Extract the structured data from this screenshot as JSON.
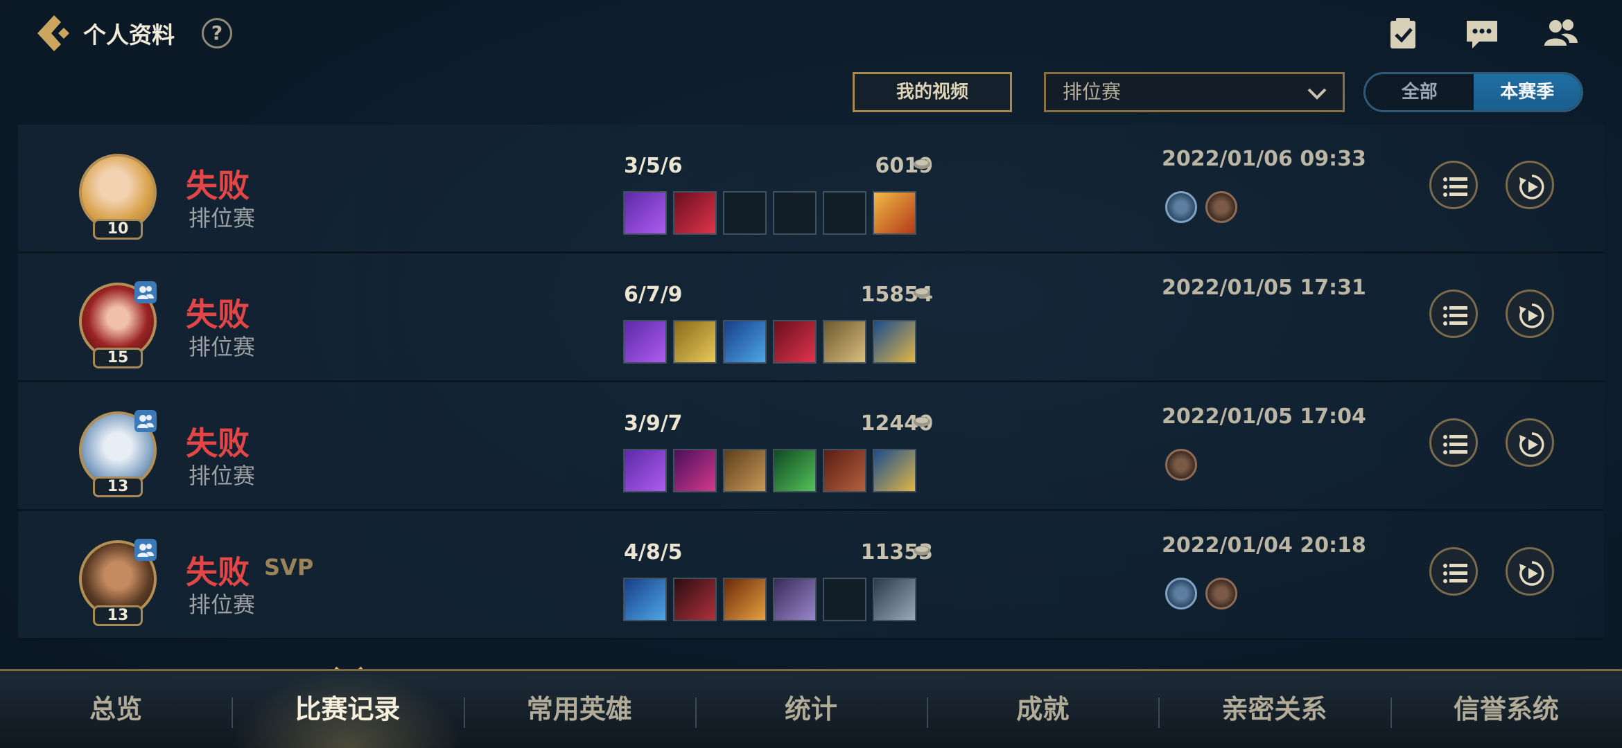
{
  "header": {
    "title": "个人资料",
    "help": "?"
  },
  "filters": {
    "video_label": "我的视频",
    "mode_selected": "排位赛",
    "season_toggle": {
      "all": "全部",
      "season": "本赛季",
      "active": "本赛季"
    }
  },
  "matches": [
    {
      "result": "失败",
      "svp": "",
      "mode": "排位赛",
      "level": "10",
      "kda": "3/5/6",
      "gold": "6019",
      "datetime": "2022/01/06 09:33",
      "party": false,
      "items": [
        "purple",
        "red",
        "empty",
        "empty",
        "empty",
        "sun"
      ],
      "medals": [
        "blue",
        "bronze"
      ]
    },
    {
      "result": "失败",
      "svp": "",
      "mode": "排位赛",
      "level": "15",
      "kda": "6/7/9",
      "gold": "15854",
      "datetime": "2022/01/05 17:31",
      "party": true,
      "items": [
        "purple",
        "gold",
        "blue",
        "red",
        "gold2",
        "ward"
      ],
      "medals": []
    },
    {
      "result": "失败",
      "svp": "",
      "mode": "排位赛",
      "level": "13",
      "kda": "3/9/7",
      "gold": "12440",
      "datetime": "2022/01/05 17:04",
      "party": true,
      "items": [
        "purple",
        "magenta",
        "bronze",
        "green",
        "book",
        "ward"
      ],
      "medals": [
        "bronze"
      ]
    },
    {
      "result": "失败",
      "svp": "SVP",
      "mode": "排位赛",
      "level": "13",
      "kda": "4/8/5",
      "gold": "11353",
      "datetime": "2022/01/04 20:18",
      "party": true,
      "items": [
        "blue",
        "darkred",
        "orange",
        "violet",
        "empty",
        "gray"
      ],
      "medals": [
        "blue",
        "bronze"
      ]
    }
  ],
  "nav": {
    "items": [
      "总览",
      "比赛记录",
      "常用英雄",
      "统计",
      "成就",
      "亲密关系",
      "信誉系统"
    ],
    "active": "比赛记录"
  },
  "colors": {
    "loss": "#e24646",
    "accent_gold": "#a88a4c",
    "toggle_blue": "#1f6fa3"
  }
}
